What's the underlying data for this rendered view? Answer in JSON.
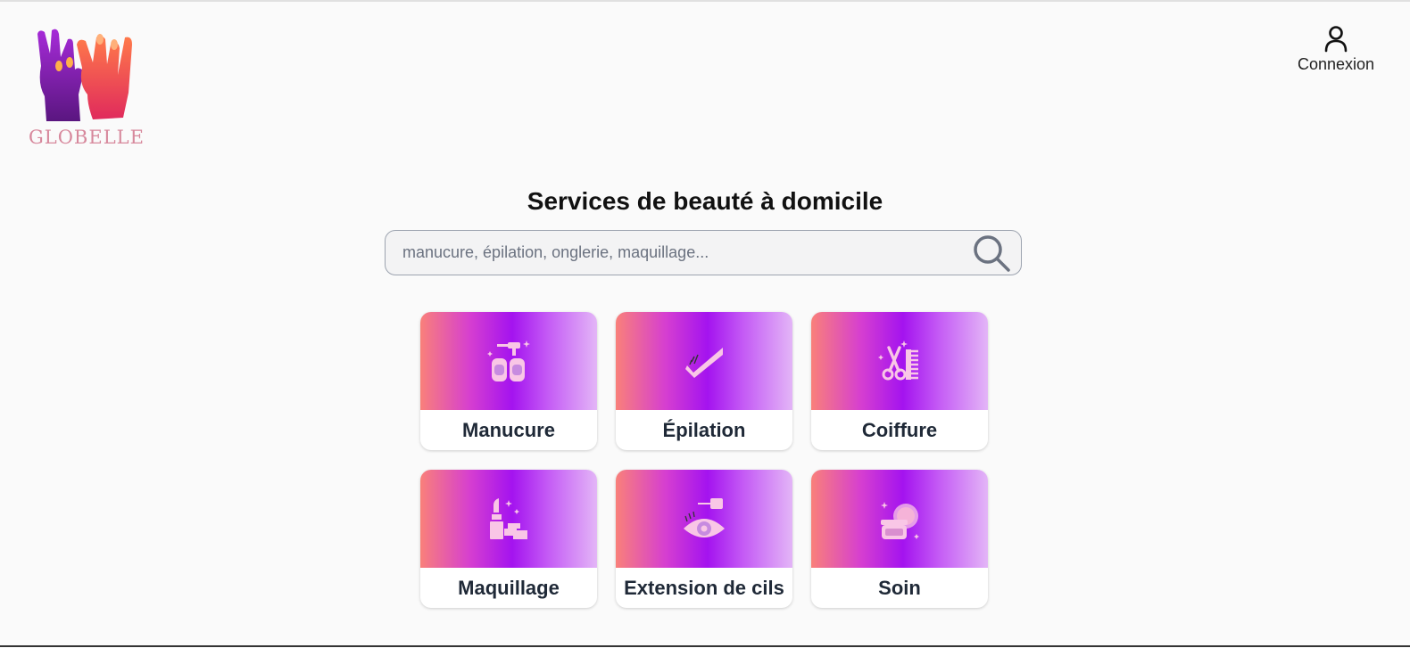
{
  "brand": {
    "logo_text": "GLOBELLE"
  },
  "header": {
    "login_label": "Connexion",
    "login_icon": "user-icon"
  },
  "hero": {
    "title": "Services de beauté à domicile",
    "search_placeholder": "manucure, épilation, onglerie, maquillage...",
    "search_icon": "search-icon"
  },
  "services": [
    {
      "label": "Manucure",
      "icon": "nail-polish-icon"
    },
    {
      "label": "Épilation",
      "icon": "wax-strip-icon"
    },
    {
      "label": "Coiffure",
      "icon": "scissors-comb-icon"
    },
    {
      "label": "Maquillage",
      "icon": "lipstick-icon"
    },
    {
      "label": "Extension de cils",
      "icon": "eye-lash-icon"
    },
    {
      "label": "Soin",
      "icon": "cream-jar-icon"
    }
  ],
  "colors": {
    "gradient_start": "#f9807a",
    "gradient_mid": "#a413ef",
    "gradient_end": "#e3b5f7",
    "icon_fill": "#f9c6e6",
    "logo_text": "#d7889c"
  }
}
